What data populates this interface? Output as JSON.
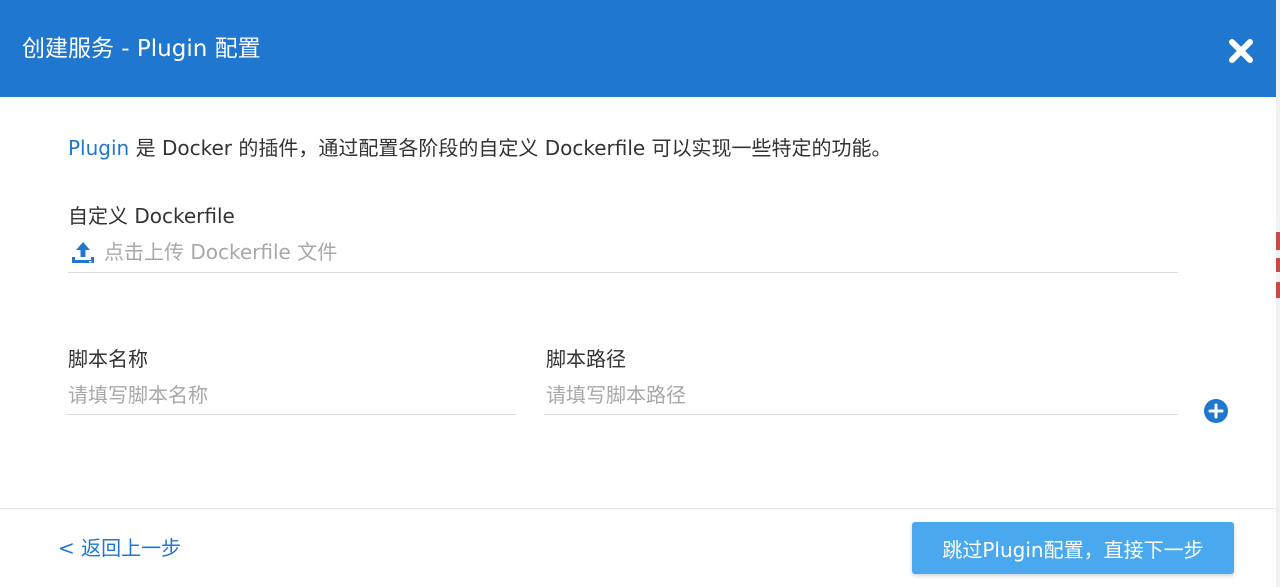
{
  "dialog": {
    "title": "创建服务 - Plugin 配置",
    "close_icon": "close-icon"
  },
  "intro": {
    "link_text": "Plugin",
    "text": " 是 Docker 的插件，通过配置各阶段的自定义 Dockerfile 可以实现一些特定的功能。"
  },
  "dockerfile": {
    "label": "自定义 Dockerfile",
    "upload_text": "点击上传 Dockerfile 文件",
    "upload_icon": "upload-icon"
  },
  "script": {
    "name_label": "脚本名称",
    "name_placeholder": "请填写脚本名称",
    "name_value": "",
    "path_label": "脚本路径",
    "path_placeholder": "请填写脚本路径",
    "path_value": "",
    "add_icon": "plus-circle-icon"
  },
  "footer": {
    "back_label": "< 返回上一步",
    "skip_label": "跳过Plugin配置，直接下一步"
  },
  "colors": {
    "header": "#1f77cf",
    "link": "#1f77cf",
    "primary_button": "#4aa8ee",
    "placeholder": "#a8a8a8",
    "text": "#333333"
  }
}
